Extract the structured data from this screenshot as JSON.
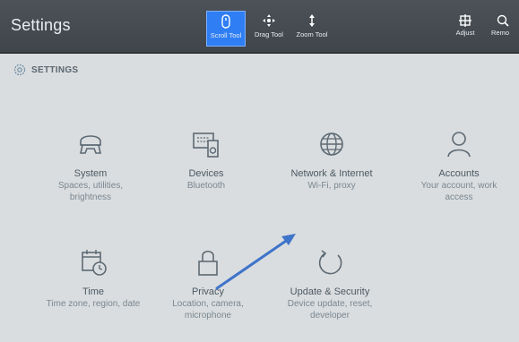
{
  "window": {
    "title": "Settings"
  },
  "toolbar": {
    "tools": [
      {
        "label": "Scroll Tool",
        "icon": "scroll-icon",
        "active": true
      },
      {
        "label": "Drag Tool",
        "icon": "drag-icon",
        "active": false
      },
      {
        "label": "Zoom Tool",
        "icon": "zoom-icon",
        "active": false
      }
    ],
    "right": [
      {
        "label": "Adjust",
        "icon": "adjust-icon"
      },
      {
        "label": "Remo",
        "icon": "remove-icon"
      }
    ]
  },
  "breadcrumb": {
    "label": "SETTINGS",
    "icon": "gear-icon"
  },
  "tiles": [
    {
      "title": "System",
      "desc": [
        "Spaces, utilities,",
        "brightness"
      ],
      "icon": "system-icon"
    },
    {
      "title": "Devices",
      "desc": [
        "Bluetooth"
      ],
      "icon": "devices-icon"
    },
    {
      "title": "Network & Internet",
      "desc": [
        "Wi-Fi, proxy"
      ],
      "icon": "globe-icon"
    },
    {
      "title": "Accounts",
      "desc": [
        "Your account, work",
        "access"
      ],
      "icon": "person-icon"
    },
    {
      "title": "Time",
      "desc": [
        "Time zone, region, date"
      ],
      "icon": "calendar-clock-icon"
    },
    {
      "title": "Privacy",
      "desc": [
        "Location, camera,",
        "microphone"
      ],
      "icon": "lock-icon"
    },
    {
      "title": "Update & Security",
      "desc": [
        "Device update, reset,",
        "developer"
      ],
      "icon": "refresh-icon"
    }
  ],
  "colors": {
    "accent": "#2f7ef4",
    "arrow": "#3f74c9",
    "topbar": "#464c52",
    "background": "#dadddf"
  }
}
